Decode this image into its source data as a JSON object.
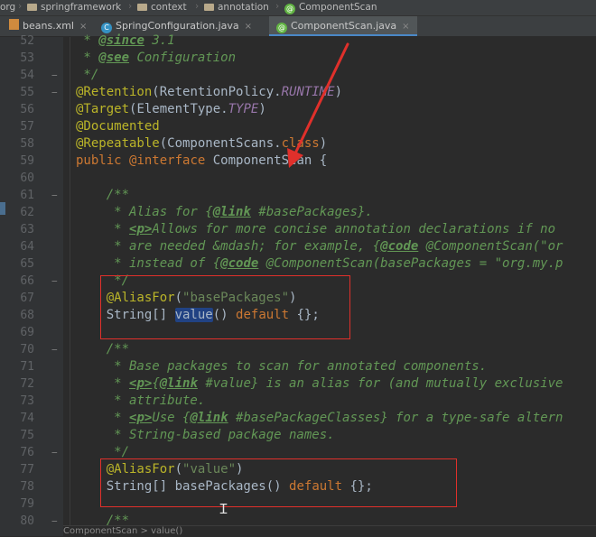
{
  "breadcrumb": {
    "items": [
      "org",
      "springframework",
      "context",
      "annotation",
      "ComponentScan"
    ]
  },
  "tabs": [
    {
      "label": "beans.xml",
      "icon": "xml-file-icon",
      "active": false
    },
    {
      "label": "SpringConfiguration.java",
      "icon": "class-icon",
      "active": false
    },
    {
      "label": "ComponentScan.java",
      "icon": "annotation-icon",
      "active": true
    }
  ],
  "tab_close_glyph": "×",
  "code_lines": [
    {
      "num": "52",
      "segments": [
        {
          "t": " * ",
          "c": "cm"
        },
        {
          "t": "@since",
          "c": "tag"
        },
        {
          "t": " 3.1",
          "c": "cm"
        }
      ]
    },
    {
      "num": "53",
      "segments": [
        {
          "t": " * ",
          "c": "cm"
        },
        {
          "t": "@see",
          "c": "tag"
        },
        {
          "t": " Configuration",
          "c": "cm"
        }
      ]
    },
    {
      "num": "54",
      "segments": [
        {
          "t": " */",
          "c": "cm"
        }
      ]
    },
    {
      "num": "55",
      "segments": [
        {
          "t": "@Retention",
          "c": "ann"
        },
        {
          "t": "(RetentionPolicy.",
          "c": ""
        },
        {
          "t": "RUNTIME",
          "c": "const"
        },
        {
          "t": ")",
          "c": ""
        }
      ]
    },
    {
      "num": "56",
      "segments": [
        {
          "t": "@Target",
          "c": "ann"
        },
        {
          "t": "(ElementType.",
          "c": ""
        },
        {
          "t": "TYPE",
          "c": "const"
        },
        {
          "t": ")",
          "c": ""
        }
      ]
    },
    {
      "num": "57",
      "segments": [
        {
          "t": "@Documented",
          "c": "ann"
        }
      ]
    },
    {
      "num": "58",
      "segments": [
        {
          "t": "@Repeatable",
          "c": "ann"
        },
        {
          "t": "(ComponentScans.",
          "c": ""
        },
        {
          "t": "class",
          "c": "kw"
        },
        {
          "t": ")",
          "c": ""
        }
      ]
    },
    {
      "num": "59",
      "segments": [
        {
          "t": "public ",
          "c": "kw"
        },
        {
          "t": "@interface ",
          "c": "kw"
        },
        {
          "t": "ComponentScan {",
          "c": ""
        }
      ]
    },
    {
      "num": "60",
      "segments": []
    },
    {
      "num": "61",
      "segments": [
        {
          "t": "    /**",
          "c": "cm"
        }
      ]
    },
    {
      "num": "62",
      "segments": [
        {
          "t": "     * Alias for {",
          "c": "cm"
        },
        {
          "t": "@link",
          "c": "tag"
        },
        {
          "t": " #basePackages}.",
          "c": "cm"
        }
      ]
    },
    {
      "num": "63",
      "segments": [
        {
          "t": "     * ",
          "c": "cm"
        },
        {
          "t": "<p>",
          "c": "tag"
        },
        {
          "t": "Allows for more concise annotation declarations if no",
          "c": "cm"
        }
      ]
    },
    {
      "num": "64",
      "segments": [
        {
          "t": "     * are needed &mdash; for example, {",
          "c": "cm"
        },
        {
          "t": "@code",
          "c": "tag"
        },
        {
          "t": " @ComponentScan(\"or",
          "c": "cm"
        }
      ]
    },
    {
      "num": "65",
      "segments": [
        {
          "t": "     * instead of {",
          "c": "cm"
        },
        {
          "t": "@code",
          "c": "tag"
        },
        {
          "t": " @ComponentScan(basePackages = \"org.my.p",
          "c": "cm"
        }
      ]
    },
    {
      "num": "66",
      "segments": [
        {
          "t": "     */",
          "c": "cm"
        }
      ]
    },
    {
      "num": "67",
      "segments": [
        {
          "t": "    @AliasFor",
          "c": "ann"
        },
        {
          "t": "(",
          "c": ""
        },
        {
          "t": "\"basePackages\"",
          "c": "str"
        },
        {
          "t": ")",
          "c": ""
        }
      ]
    },
    {
      "num": "68",
      "segments": [
        {
          "t": "    String[] ",
          "c": ""
        },
        {
          "t": "value",
          "c": "sel"
        },
        {
          "t": "() ",
          "c": ""
        },
        {
          "t": "default ",
          "c": "kw"
        },
        {
          "t": "{};",
          "c": ""
        }
      ]
    },
    {
      "num": "69",
      "segments": []
    },
    {
      "num": "70",
      "segments": [
        {
          "t": "    /**",
          "c": "cm"
        }
      ]
    },
    {
      "num": "71",
      "segments": [
        {
          "t": "     * Base packages to scan for annotated components.",
          "c": "cm"
        }
      ]
    },
    {
      "num": "72",
      "segments": [
        {
          "t": "     * ",
          "c": "cm"
        },
        {
          "t": "<p>",
          "c": "tag"
        },
        {
          "t": "{",
          "c": "cm"
        },
        {
          "t": "@link",
          "c": "tag"
        },
        {
          "t": " #value} is an alias for (and mutually exclusive",
          "c": "cm"
        }
      ]
    },
    {
      "num": "73",
      "segments": [
        {
          "t": "     * attribute.",
          "c": "cm"
        }
      ]
    },
    {
      "num": "74",
      "segments": [
        {
          "t": "     * ",
          "c": "cm"
        },
        {
          "t": "<p>",
          "c": "tag"
        },
        {
          "t": "Use {",
          "c": "cm"
        },
        {
          "t": "@link",
          "c": "tag"
        },
        {
          "t": " #basePackageClasses} for a type-safe altern",
          "c": "cm"
        }
      ]
    },
    {
      "num": "75",
      "segments": [
        {
          "t": "     * String-based package names.",
          "c": "cm"
        }
      ]
    },
    {
      "num": "76",
      "segments": [
        {
          "t": "     */",
          "c": "cm"
        }
      ]
    },
    {
      "num": "77",
      "segments": [
        {
          "t": "    @AliasFor",
          "c": "ann"
        },
        {
          "t": "(",
          "c": ""
        },
        {
          "t": "\"value\"",
          "c": "str"
        },
        {
          "t": ")",
          "c": ""
        }
      ]
    },
    {
      "num": "78",
      "segments": [
        {
          "t": "    String[] ",
          "c": ""
        },
        {
          "t": "basePackages",
          "c": ""
        },
        {
          "t": "() ",
          "c": ""
        },
        {
          "t": "default ",
          "c": "kw"
        },
        {
          "t": "{};",
          "c": ""
        }
      ]
    },
    {
      "num": "79",
      "segments": []
    },
    {
      "num": "80",
      "segments": [
        {
          "t": "    /**",
          "c": "cm"
        }
      ]
    }
  ],
  "status_text": "ComponentScan  >  value()",
  "colors": {
    "annotation_box": "#e0302b",
    "arrow": "#e0302b"
  }
}
